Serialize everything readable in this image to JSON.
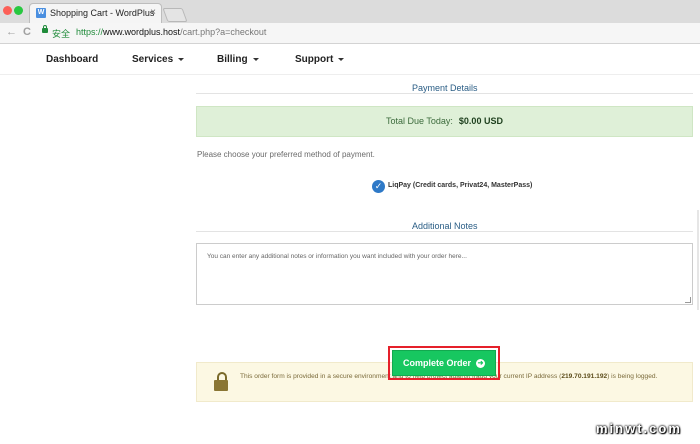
{
  "browser": {
    "tab_title": "Shopping Cart - WordPlus",
    "tab_favicon": "W",
    "tab_close": "×",
    "secure_label": "安全",
    "url_scheme": "https://",
    "url_host": "www.wordplus.host",
    "url_path": "/cart.php?a=checkout",
    "back_icon": "←",
    "reload_icon": "C"
  },
  "nav": {
    "items": [
      {
        "label": "Dashboard"
      },
      {
        "label": "Services"
      },
      {
        "label": "Billing"
      },
      {
        "label": "Support"
      }
    ]
  },
  "payment": {
    "section_title": "Payment Details",
    "total_label": "Total Due Today:",
    "total_amount": "$0.00 USD",
    "choose_text": "Please choose your preferred method of payment.",
    "method_label": "LiqPay (Credit cards, Privat24, MasterPass)",
    "method_check": "✓"
  },
  "notes": {
    "section_title": "Additional Notes",
    "placeholder": "You can enter any additional notes or information you want included with your order here..."
  },
  "order": {
    "button_label": "Complete Order",
    "button_icon": "➜"
  },
  "security": {
    "text_before": "This order form is provided in a secure environment and to help protect against fraud your current IP address (",
    "ip": "219.70.191.192",
    "text_after": ") is being logged."
  },
  "watermark": "minwt.com",
  "colors": {
    "accent": "#2e79c7",
    "success_bg": "#dff0d8",
    "order_button": "#17c760",
    "highlight_outline": "#e5202a",
    "warning_bg": "#fcf8e3"
  }
}
